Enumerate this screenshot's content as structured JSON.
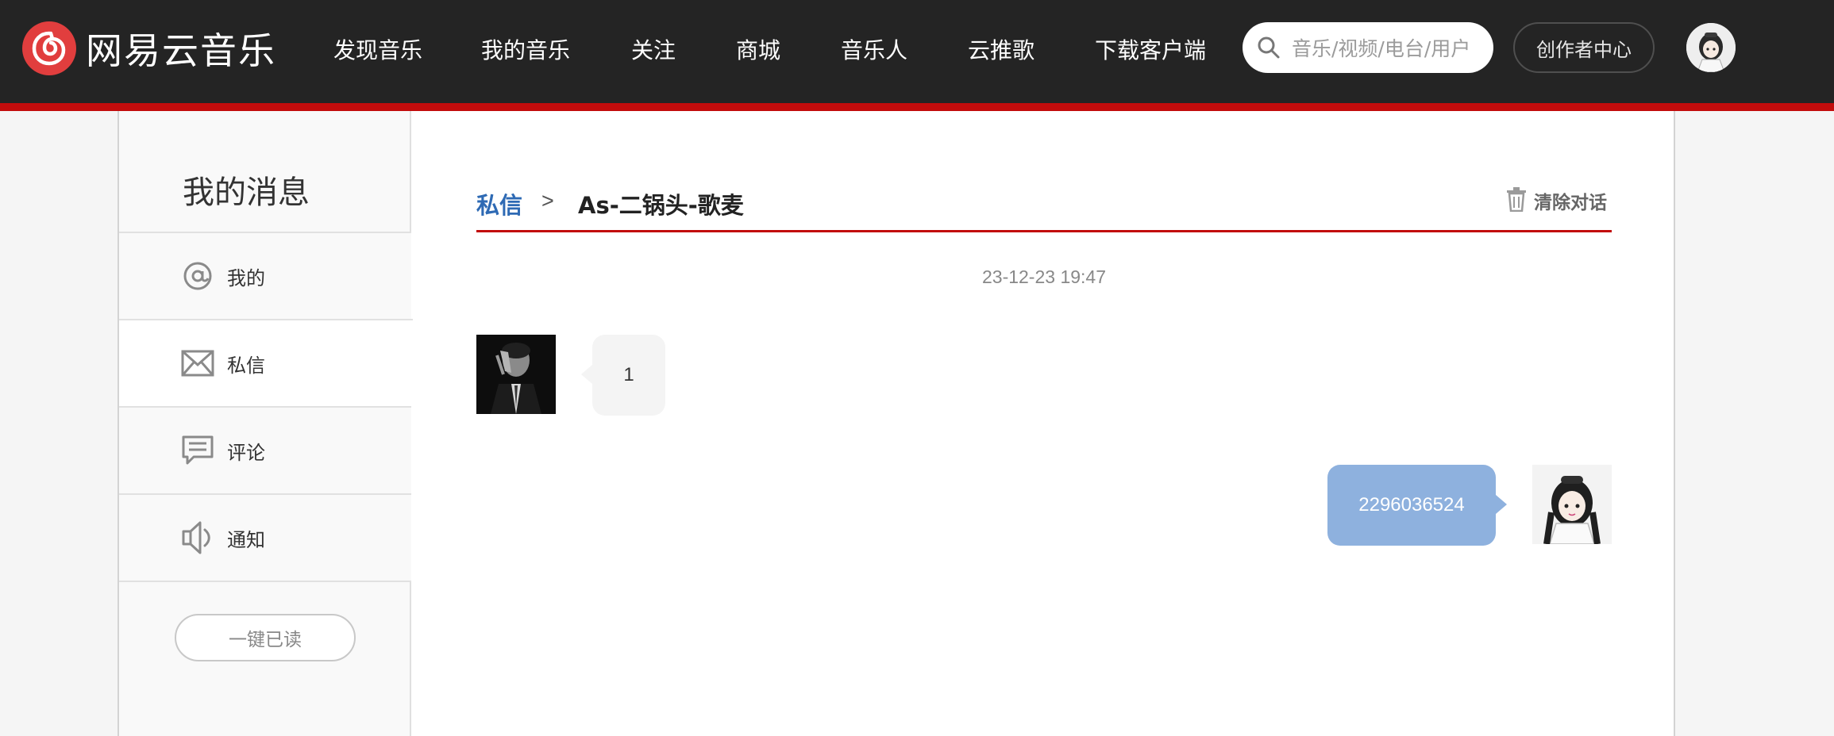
{
  "header": {
    "logo_text": "网易云音乐",
    "nav": [
      {
        "label": "发现音乐"
      },
      {
        "label": "我的音乐"
      },
      {
        "label": "关注"
      },
      {
        "label": "商城"
      },
      {
        "label": "音乐人"
      },
      {
        "label": "云推歌"
      },
      {
        "label": "下载客户端"
      }
    ],
    "search_placeholder": "音乐/视频/电台/用户",
    "creator_center": "创作者中心",
    "accent_color": "#c20c0c",
    "bar_color": "#242424"
  },
  "sidebar": {
    "title": "我的消息",
    "items": [
      {
        "label": "我的",
        "icon": "at-icon"
      },
      {
        "label": "私信",
        "icon": "mail-icon"
      },
      {
        "label": "评论",
        "icon": "comment-icon"
      },
      {
        "label": "通知",
        "icon": "speaker-icon"
      }
    ],
    "active": "私信",
    "read_all": "一键已读"
  },
  "conversation": {
    "breadcrumb_root": "私信",
    "breadcrumb_sep": ">",
    "title": "As-二锅头-歌麦",
    "clear_label": "清除对话",
    "timestamp": "23-12-23 19:47",
    "messages": [
      {
        "direction": "in",
        "text": "1"
      },
      {
        "direction": "out",
        "text": "2296036524"
      }
    ],
    "out_bubble_color": "#8eb1de",
    "in_bubble_color": "#f4f4f4",
    "link_color": "#2e6ab4"
  }
}
